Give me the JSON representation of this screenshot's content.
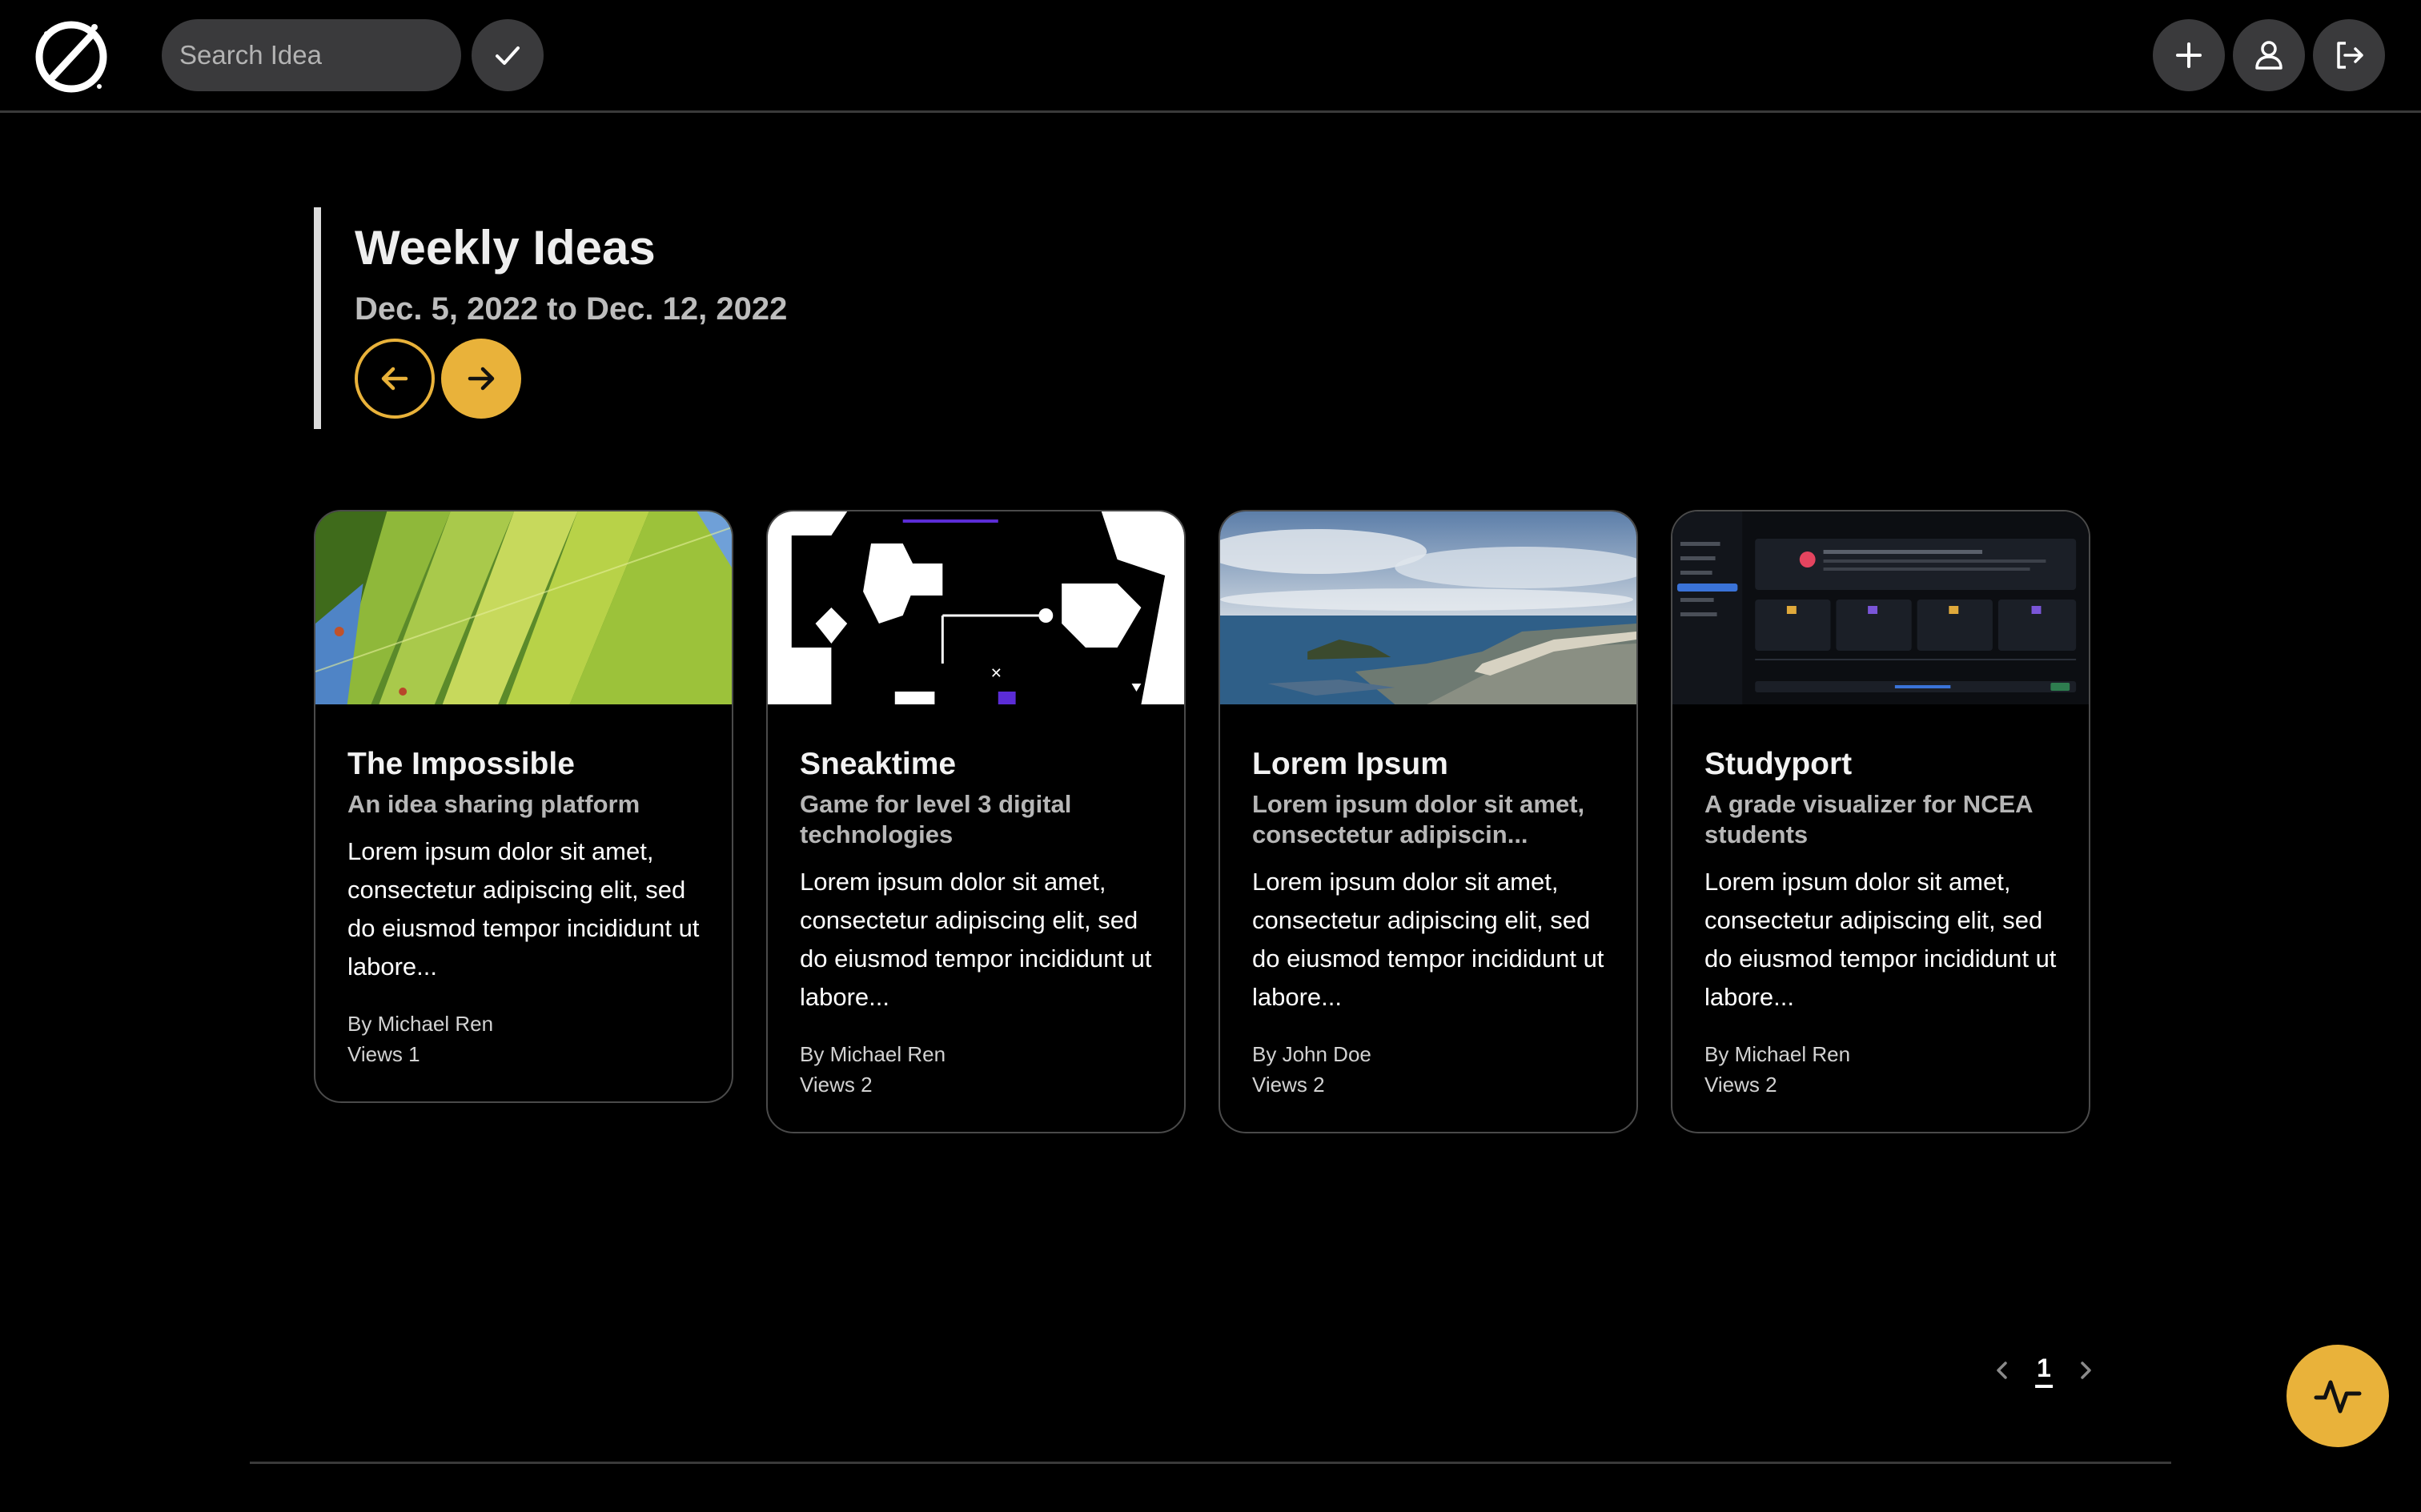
{
  "header": {
    "logo_icon": "planet-logo-icon",
    "search": {
      "placeholder": "Search Idea",
      "value": ""
    },
    "confirm_icon": "check-icon",
    "actions": [
      {
        "icon": "plus-icon"
      },
      {
        "icon": "user-icon"
      },
      {
        "icon": "logout-icon"
      }
    ]
  },
  "weekly": {
    "title": "Weekly Ideas",
    "date_range": "Dec. 5, 2022 to Dec. 12, 2022",
    "prev_icon": "arrow-left-icon",
    "next_icon": "arrow-right-icon",
    "accent_color": "#e9b23a"
  },
  "cards": [
    {
      "title": "The Impossible",
      "subtitle": "An idea sharing platform",
      "description": "Lorem ipsum dolor sit amet, consectetur adipiscing elit, sed do eiusmod tempor incididunt ut labore...",
      "author": "By Michael Ren",
      "views": "Views 1",
      "image": "green-leaves-photo"
    },
    {
      "title": "Sneaktime",
      "subtitle": "Game for level 3 digital technologies",
      "description": "Lorem ipsum dolor sit amet, consectetur adipiscing elit, sed do eiusmod tempor incididunt ut labore...",
      "author": "By Michael Ren",
      "views": "Views 2",
      "image": "game-level-screenshot"
    },
    {
      "title": "Lorem Ipsum",
      "subtitle": "Lorem ipsum dolor sit amet, consectetur adipiscin...",
      "description": "Lorem ipsum dolor sit amet, consectetur adipiscing elit, sed do eiusmod tempor incididunt ut labore...",
      "author": "By John Doe",
      "views": "Views 2",
      "image": "coastal-town-photo"
    },
    {
      "title": "Studyport",
      "subtitle": "A grade visualizer for NCEA students",
      "description": "Lorem ipsum dolor sit amet, consectetur adipiscing elit, sed do eiusmod tempor incididunt ut labore...",
      "author": "By Michael Ren",
      "views": "Views 2",
      "image": "dashboard-app-screenshot"
    }
  ],
  "pagination": {
    "current_page": "1",
    "prev_icon": "chevron-left-icon",
    "next_icon": "chevron-right-icon"
  },
  "fab": {
    "icon": "activity-pulse-icon"
  }
}
